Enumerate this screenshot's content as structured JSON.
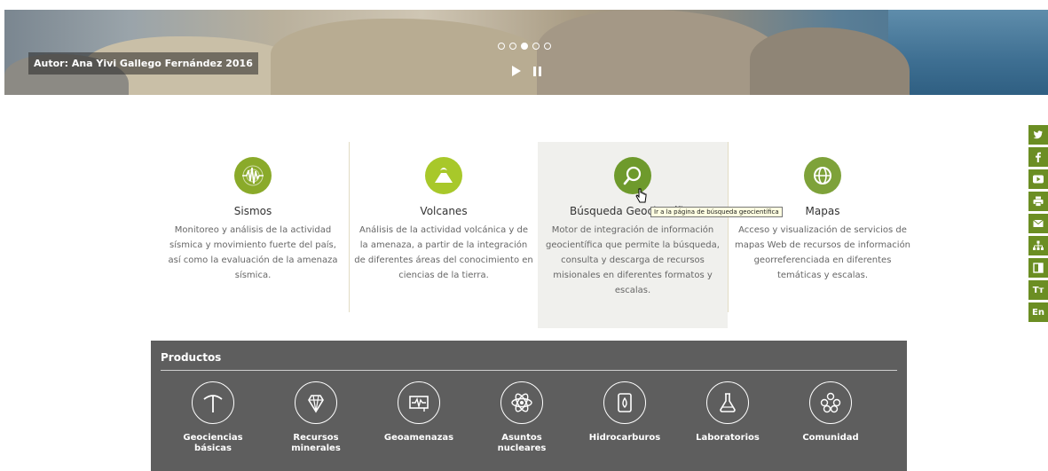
{
  "banner": {
    "credit": "Autor: Ana Yivi Gallego Fernández 2016",
    "slides": 5,
    "active_slide": 3
  },
  "features": [
    {
      "title": "Sismos",
      "description": "Monitoreo y análisis de la actividad sísmica y movimiento fuerte del país, así como la evaluación de la amenaza sísmica.",
      "icon": "seismic-wave-icon",
      "color": "#8aaa2a"
    },
    {
      "title": "Volcanes",
      "description": "Análisis de la actividad volcánica y de la amenaza, a partir de la integración de diferentes áreas del conocimiento en ciencias de la tierra.",
      "icon": "volcano-icon",
      "color": "#a8c82a"
    },
    {
      "title": "Búsqueda Geocientífica",
      "description": "Motor de integración de información geocientífica que permite la búsqueda, consulta y descarga de recursos misionales en diferentes formatos y escalas.",
      "icon": "search-icon",
      "color": "#6e9a2c"
    },
    {
      "title": "Mapas",
      "description": "Acceso y visualización de servicios de mapas Web de recursos de información georreferenciada en diferentes temáticas y escalas.",
      "icon": "globe-icon",
      "color": "#7ea23a"
    }
  ],
  "tooltip": "Ir a la página de búsqueda geocientífica",
  "products": {
    "title": "Productos",
    "items": [
      {
        "label": "Geociencias básicas",
        "icon": "pickaxe-icon"
      },
      {
        "label": "Recursos minerales",
        "icon": "crystal-icon"
      },
      {
        "label": "Geoamenazas",
        "icon": "seismograph-icon"
      },
      {
        "label": "Asuntos nucleares",
        "icon": "atom-icon"
      },
      {
        "label": "Hidrocarburos",
        "icon": "oil-drop-icon"
      },
      {
        "label": "Laboratorios",
        "icon": "flask-icon"
      },
      {
        "label": "Comunidad",
        "icon": "community-icon"
      }
    ]
  },
  "social": [
    {
      "icon": "twitter-icon",
      "text": ""
    },
    {
      "icon": "facebook-icon",
      "text": ""
    },
    {
      "icon": "youtube-icon",
      "text": ""
    },
    {
      "icon": "print-icon",
      "text": ""
    },
    {
      "icon": "mail-icon",
      "text": ""
    },
    {
      "icon": "sitemap-icon",
      "text": ""
    },
    {
      "icon": "contrast-icon",
      "text": ""
    },
    {
      "icon": "text-size-icon",
      "text": "Tт"
    },
    {
      "icon": "language-icon",
      "text": "En"
    }
  ],
  "colors": {
    "accent": "#6b8e23",
    "products_bg": "#5e5e5e",
    "highlight_bg": "#f0f0ed"
  }
}
